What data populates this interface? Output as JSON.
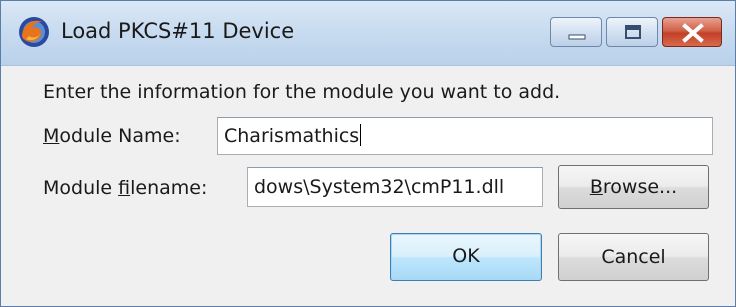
{
  "window": {
    "title": "Load PKCS#11 Device"
  },
  "form": {
    "prompt": "Enter the information for the module you want to add.",
    "module_name_label_key": "M",
    "module_name_label_rest": "odule Name:",
    "module_name_value": "Charismathics",
    "module_filename_label_pre": "Module ",
    "module_filename_label_key": "f",
    "module_filename_label_rest": "ilename:",
    "module_filename_value": "dows\\System32\\cmP11.dll"
  },
  "buttons": {
    "browse_key": "B",
    "browse_rest": "rowse...",
    "ok": "OK",
    "cancel": "Cancel"
  },
  "icons": {
    "app": "firefox-icon",
    "minimize": "minimize-icon",
    "maximize": "maximize-icon",
    "close": "close-icon"
  }
}
